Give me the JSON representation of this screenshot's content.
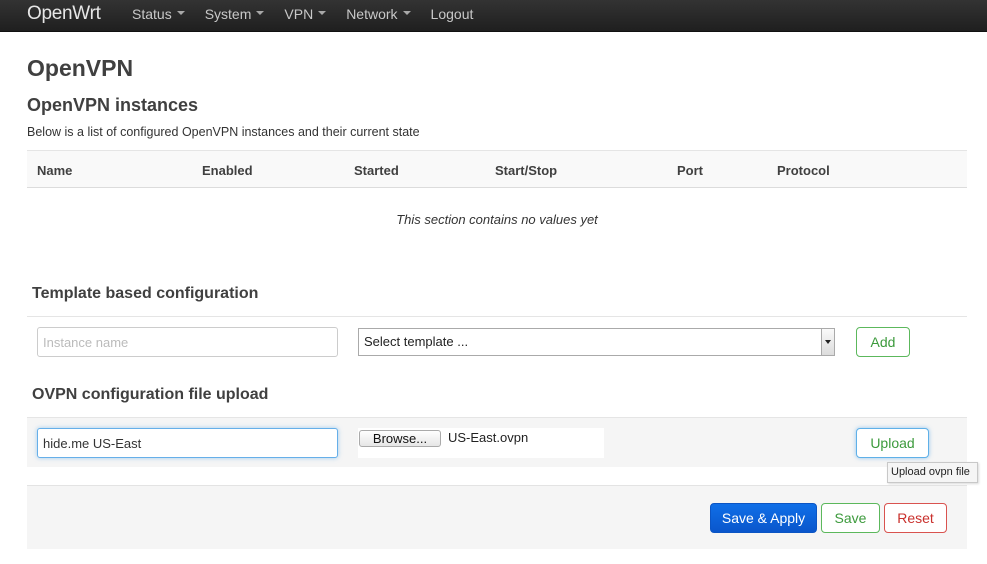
{
  "navbar": {
    "brand": "OpenWrt",
    "items": [
      {
        "label": "Status",
        "has_caret": true
      },
      {
        "label": "System",
        "has_caret": true
      },
      {
        "label": "VPN",
        "has_caret": true
      },
      {
        "label": "Network",
        "has_caret": true
      },
      {
        "label": "Logout",
        "has_caret": false
      }
    ]
  },
  "page": {
    "title": "OpenVPN",
    "instances_title": "OpenVPN instances",
    "instances_desc": "Below is a list of configured OpenVPN instances and their current state"
  },
  "table": {
    "columns": [
      "Name",
      "Enabled",
      "Started",
      "Start/Stop",
      "Port",
      "Protocol"
    ],
    "empty_message": "This section contains no values yet"
  },
  "template_config": {
    "title": "Template based configuration",
    "instance_placeholder": "Instance name",
    "instance_value": "",
    "template_selected": "Select template ...",
    "add_label": "Add"
  },
  "upload_config": {
    "title": "OVPN configuration file upload",
    "name_value": "hide.me US-East",
    "browse_label": "Browse...",
    "file_name": "US-East.ovpn",
    "upload_label": "Upload",
    "tooltip": "Upload ovpn file"
  },
  "footer": {
    "save_apply_label": "Save & Apply",
    "save_label": "Save",
    "reset_label": "Reset"
  },
  "colors": {
    "navbar_bg": "#1f1f1f",
    "primary_blue": "#0a56cc",
    "success_green": "#5cb85c",
    "danger_red": "#d9534f"
  }
}
